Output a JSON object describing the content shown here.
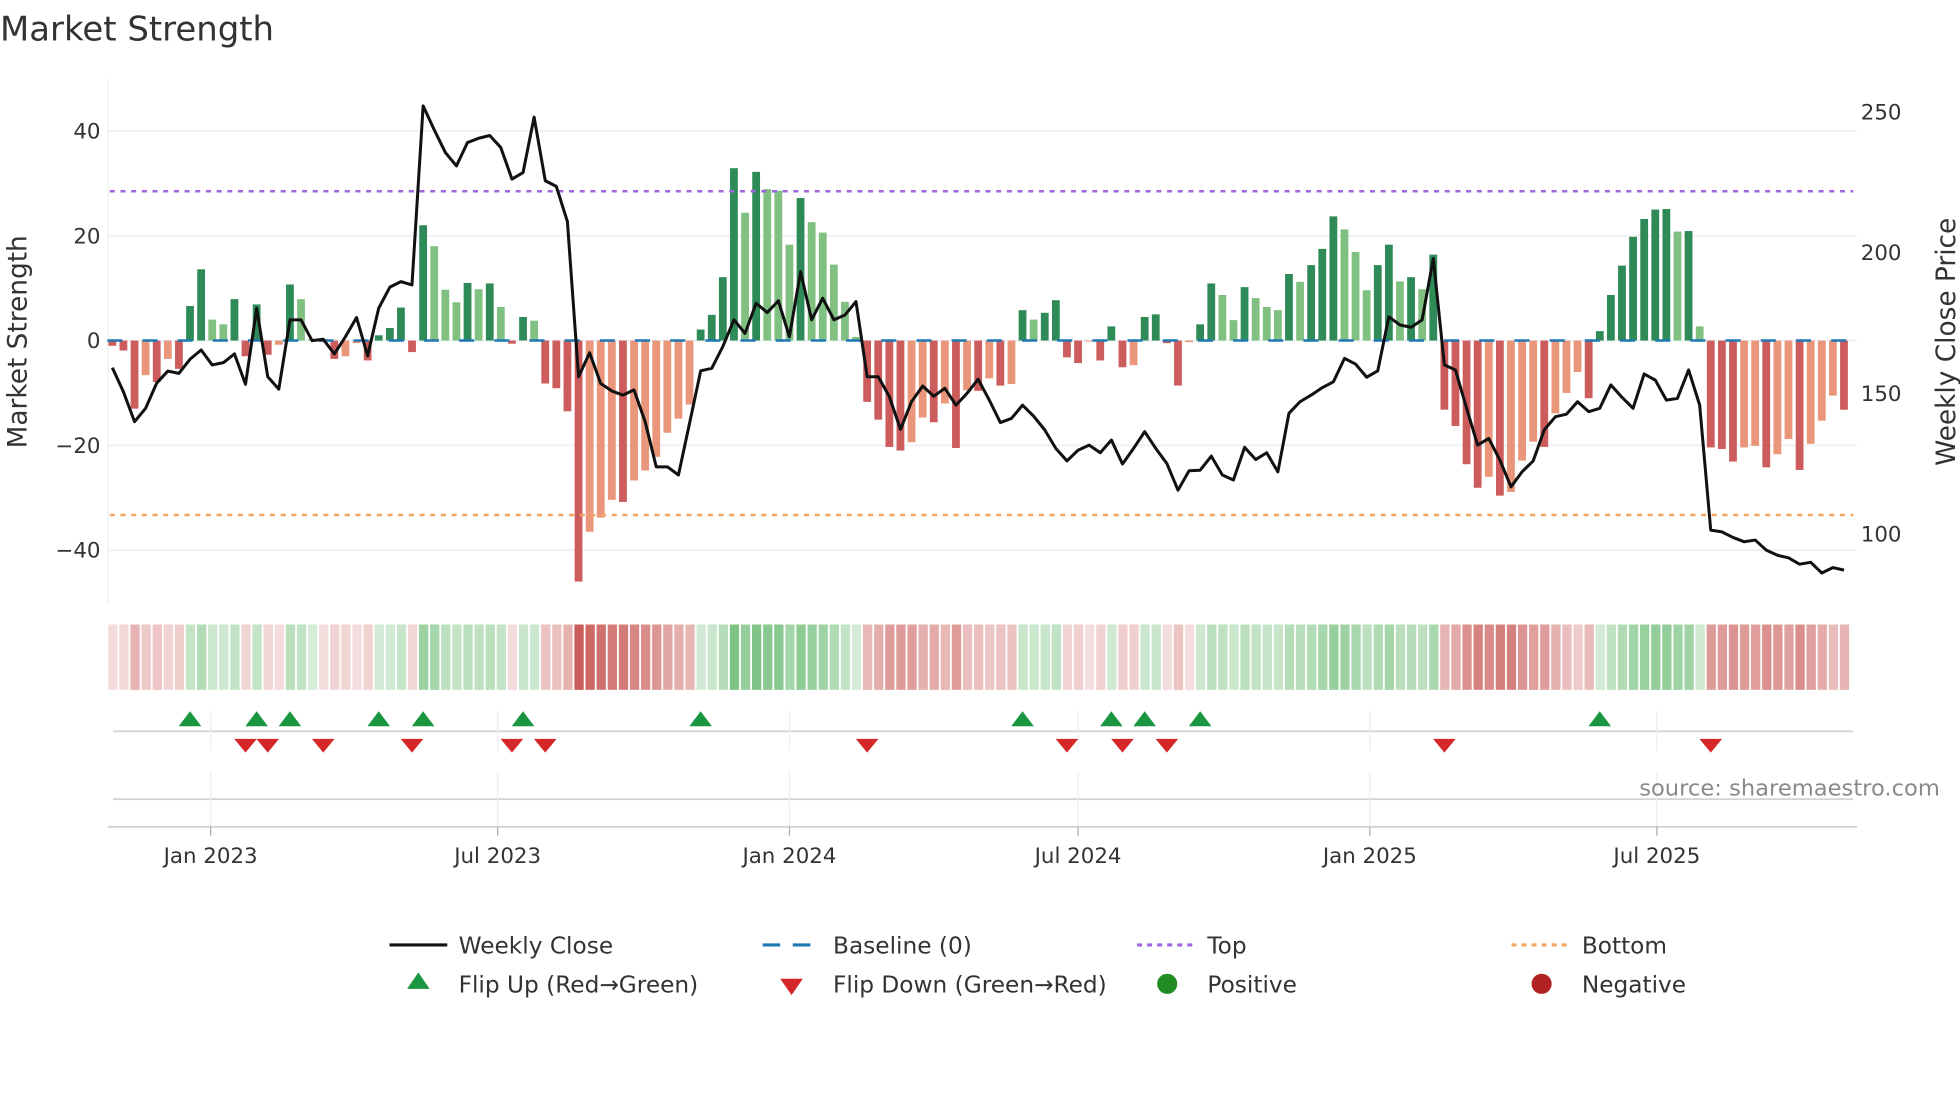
{
  "chart_data": {
    "type": "bar+line",
    "title": "Market Strength",
    "ylabel": "Market Strength",
    "y2label": "Weekly Close Price",
    "ylim": [
      -50,
      50
    ],
    "y2lim": [
      75.7,
      261.8
    ],
    "yticks": [
      40,
      20,
      0,
      -20,
      -40
    ],
    "yticklabels": [
      "40",
      "20",
      "0",
      "−20",
      "−40"
    ],
    "y2ticks": [
      250,
      200,
      150,
      100
    ],
    "y2ticklabels": [
      "250",
      "200",
      "150",
      "100"
    ],
    "start_date": "2022-10-31",
    "frequency": "weekly",
    "xticks": [
      {
        "date": "2023-01-01",
        "label": "Jan 2023"
      },
      {
        "date": "2023-07-01",
        "label": "Jul 2023"
      },
      {
        "date": "2024-01-01",
        "label": "Jan 2024"
      },
      {
        "date": "2024-07-01",
        "label": "Jul 2024"
      },
      {
        "date": "2025-01-01",
        "label": "Jan 2025"
      },
      {
        "date": "2025-07-01",
        "label": "Jul 2025"
      }
    ],
    "top_level": 28.5,
    "bottom_level": -33.3,
    "baseline": 0,
    "strength": [
      -1,
      -1.9,
      -13,
      -6.6,
      -7.9,
      -3.5,
      -5.4,
      6.6,
      13.6,
      4.0,
      3.1,
      7.9,
      -3.0,
      6.9,
      -2.7,
      -0.8,
      10.7,
      7.9,
      0.3,
      -0.3,
      -3.5,
      -3.0,
      -0.5,
      -3.8,
      1.0,
      2.4,
      6.3,
      -2.2,
      22,
      18,
      9.7,
      7.3,
      11,
      9.8,
      10.9,
      6.4,
      -0.6,
      4.5,
      3.8,
      -8.2,
      -9.1,
      -13.5,
      -46,
      -36.5,
      -33.8,
      -30.4,
      -30.8,
      -26.7,
      -24.8,
      -22.2,
      -17.6,
      -14.9,
      -12.2,
      2.1,
      4.9,
      12.1,
      32.9,
      24.4,
      32.2,
      28.9,
      28.6,
      18.3,
      27.2,
      22.6,
      20.6,
      14.5,
      7.4,
      0.7,
      -11.7,
      -15.1,
      -20.3,
      -21,
      -19.4,
      -14.7,
      -15.6,
      -12,
      -20.5,
      -9.5,
      -9.6,
      -7.2,
      -8.6,
      -8.3,
      5.8,
      4.0,
      5.3,
      7.7,
      -3.2,
      -4.3,
      -0.2,
      -3.8,
      2.7,
      -5.1,
      -4.7,
      4.5,
      5.0,
      -0.5,
      -8.6,
      -0.3,
      3.1,
      10.9,
      8.7,
      3.9,
      10.2,
      8.1,
      6.4,
      5.8,
      12.7,
      11.2,
      14.4,
      17.5,
      23.7,
      21.2,
      16.9,
      9.6,
      14.4,
      18.3,
      11.3,
      12.1,
      9.8,
      16.4,
      -13.2,
      -16.3,
      -23.6,
      -28.1,
      -26,
      -29.6,
      -28.9,
      -22.9,
      -19.3,
      -20.3,
      -13.9,
      -10,
      -6,
      -11,
      1.8,
      8.7,
      14.3,
      19.8,
      23.2,
      25,
      25.1,
      20.8,
      20.9,
      2.7,
      -20.4,
      -20.7,
      -23.1,
      -20.4,
      -20.1,
      -24.2,
      -21.7,
      -18.8,
      -24.7,
      -19.7,
      -15.3,
      -10.5,
      -13.2
    ],
    "weekly_close": [
      159.1,
      150.6,
      139.9,
      144.7,
      153.6,
      157.9,
      157.1,
      162.1,
      165.4,
      160.1,
      160.9,
      164,
      153.2,
      180.2,
      155.9,
      151.5,
      176.1,
      176.1,
      168.7,
      169.2,
      164,
      170.1,
      176.9,
      163.3,
      180.2,
      187.7,
      189.7,
      188.5,
      252.1,
      243.6,
      235.5,
      230.8,
      239.1,
      240.6,
      241.6,
      237.3,
      226.1,
      228.4,
      248.1,
      225.5,
      223.5,
      211,
      155.9,
      164.4,
      153.5,
      150.8,
      149.4,
      151.2,
      139.9,
      123.9,
      123.9,
      121,
      139.3,
      158,
      158.9,
      166.6,
      176.1,
      171.3,
      182,
      178.7,
      182.9,
      170.1,
      193.2,
      176.1,
      183.8,
      176.1,
      177.8,
      182.6,
      155.9,
      155.9,
      148.8,
      137.2,
      147,
      152.6,
      149,
      151.8,
      145.8,
      150,
      155,
      147.6,
      139.6,
      141.1,
      145.8,
      141.9,
      137,
      130.4,
      126,
      129.8,
      131.6,
      128.9,
      133.4,
      124.9,
      130.4,
      136.4,
      130.4,
      125.1,
      115.6,
      122.5,
      122.7,
      127.7,
      121,
      119.2,
      130.8,
      126.5,
      128.9,
      122.1,
      142.9,
      147,
      149.4,
      152,
      154.1,
      162.4,
      160.4,
      155.7,
      158,
      177.2,
      174.3,
      173.5,
      176.1,
      197.9,
      160.1,
      158.3,
      144.7,
      131.6,
      134,
      126.3,
      116.8,
      122.1,
      126,
      137,
      141.7,
      142.6,
      147,
      143.5,
      144.7,
      153,
      148.6,
      144.7,
      156.9,
      154.7,
      147.6,
      148.2,
      158.3,
      145.8,
      101.4,
      100.8,
      98.8,
      97.3,
      97.9,
      94.3,
      92.5,
      91.6,
      89.3,
      90,
      86.2,
      88.1,
      87.2
    ],
    "flip_up_weeks": [
      7,
      13,
      16,
      24,
      28,
      37,
      53,
      82,
      90,
      93,
      98,
      134
    ],
    "flip_down_weeks": [
      12,
      14,
      19,
      27,
      36,
      39,
      68,
      86,
      91,
      95,
      120,
      144
    ],
    "legend": {
      "weekly_close": "Weekly Close",
      "baseline": "Baseline (0)",
      "top": "Top",
      "bottom": "Bottom",
      "flip_up": "Flip Up (Red→Green)",
      "flip_down": "Flip Down (Green→Red)",
      "positive": "Positive",
      "negative": "Negative"
    },
    "legend_position": "bottom",
    "source": "source: sharemaestro.com"
  },
  "colors": {
    "pos_strong": "#2e8b57",
    "pos_weak": "#80c080",
    "neg_strong": "#cd5c5c",
    "neg_weak": "#e9967a",
    "line": "#111111",
    "baseline": "#1f77b4",
    "top": "#a066e0",
    "bottom": "#f4a460",
    "flip_up": "#1a9641",
    "flip_down": "#d62728",
    "positive": "#228b22",
    "negative": "#b22222"
  }
}
